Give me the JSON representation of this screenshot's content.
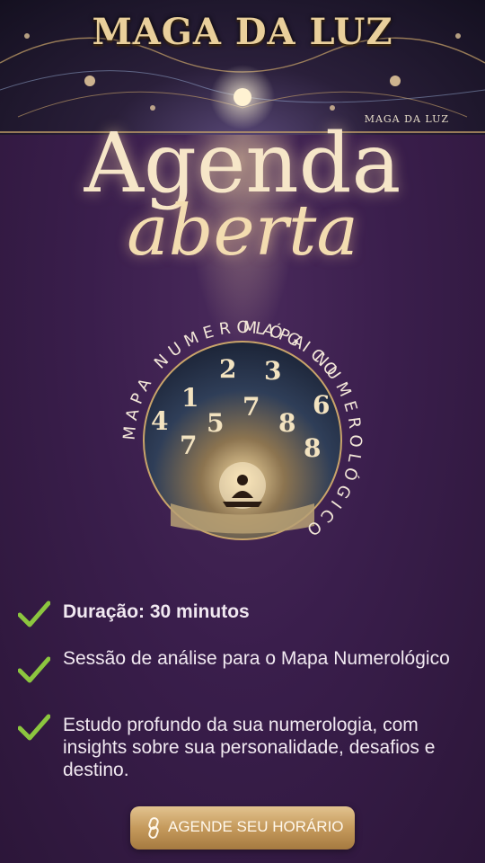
{
  "banner": {
    "brand_title": "MAGA DA LUZ",
    "brand_small": "MAGA DA LUZ"
  },
  "headline": "Agenda",
  "subheadline": "aberta",
  "emblem": {
    "ring_text_top": "MAPA NUMEROLÓGICO",
    "ring_text_right": "MAPA NUMEROLÓGICO",
    "numbers": [
      "2",
      "3",
      "1",
      "7",
      "4",
      "5",
      "6",
      "8",
      "7",
      "8"
    ]
  },
  "features": [
    {
      "text": "Duração: 30 minutos",
      "icon": "check-icon"
    },
    {
      "text": "Sessão de análise para o Mapa Numerológico",
      "icon": "check-icon"
    },
    {
      "text": "Estudo profundo da sua numerologia, com insights sobre sua personalidade, desafios e destino.",
      "icon": "check-icon"
    }
  ],
  "cta": {
    "label": "AGENDE SEU HORÁRIO",
    "icon": "link-icon"
  },
  "colors": {
    "accent_gold": "#e2c38f",
    "check_green": "#8cc63f",
    "background": "#3a1e4c"
  }
}
